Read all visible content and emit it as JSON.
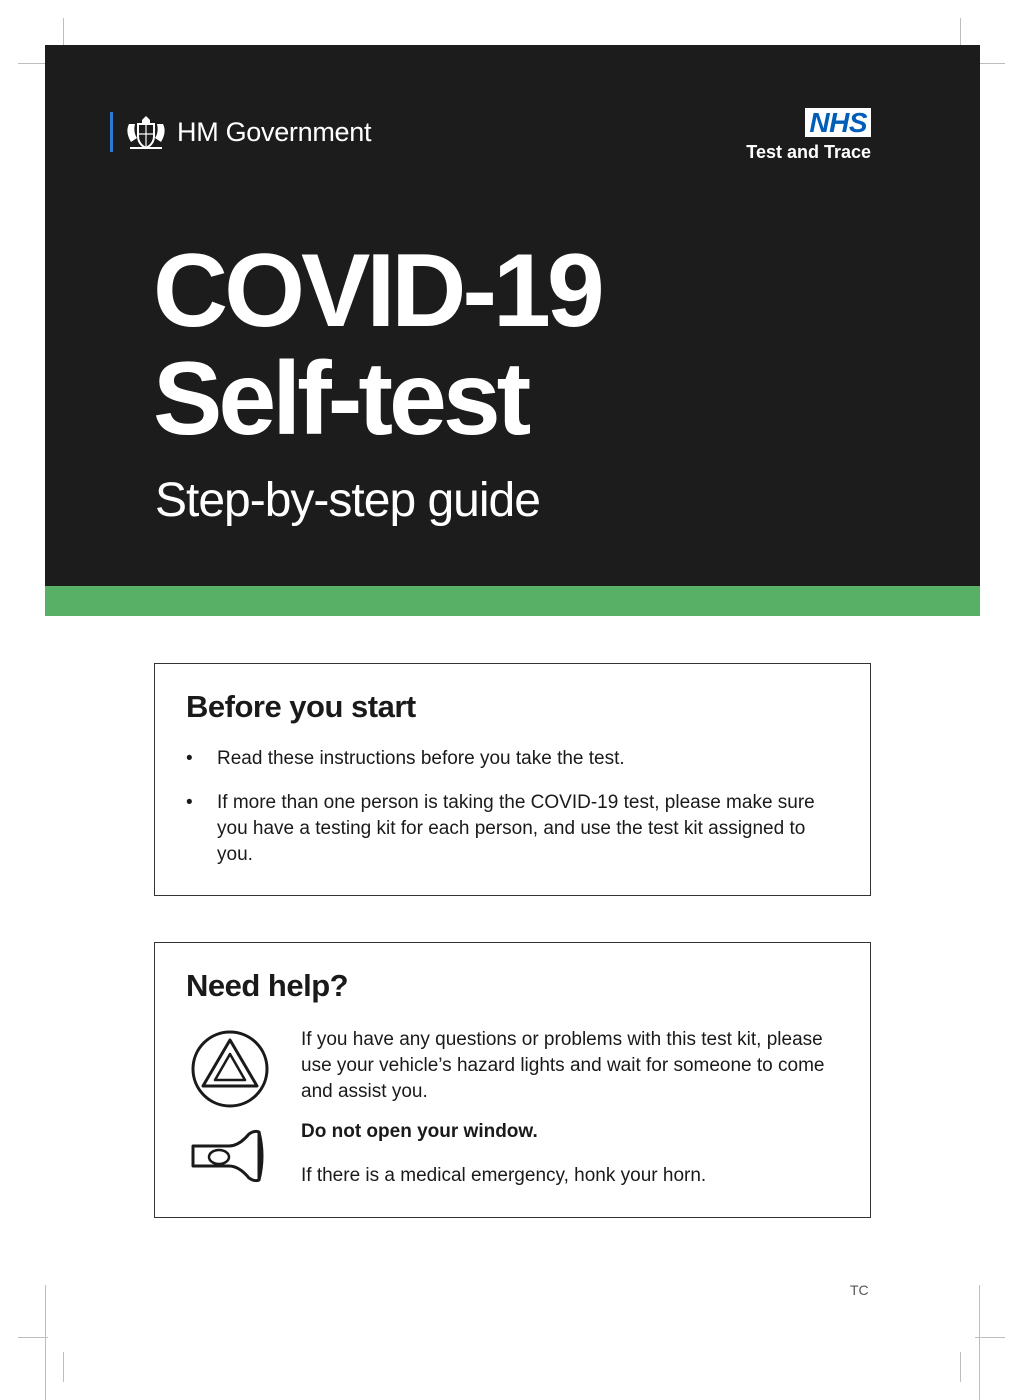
{
  "header": {
    "gov_logo_text": "HM Government",
    "nhs_badge": "NHS",
    "nhs_subtitle": "Test and Trace",
    "title_line1": "COVID-19",
    "title_line2": "Self-test",
    "subtitle": "Step-by-step guide"
  },
  "before_you_start": {
    "heading": "Before you start",
    "items": [
      "Read these instructions before you take the test.",
      "If more than one person is taking the COVID-19 test, please make sure you have a testing kit for each person, and use the test kit assigned to you."
    ]
  },
  "need_help": {
    "heading": "Need help?",
    "body": "If you have any questions or problems with this test kit, please use your vehicle’s hazard lights and wait for someone to come and assist you.",
    "warning": "Do not open your window.",
    "emergency": "If there is a medical emergency, honk your horn.",
    "icons": [
      "hazard-icon",
      "horn-icon"
    ]
  },
  "footer": {
    "code": "TC"
  },
  "colors": {
    "hero_bg": "#1c1c1c",
    "accent_green": "#57b065",
    "nhs_blue": "#005eb8",
    "gov_blue": "#2a7bd6"
  }
}
